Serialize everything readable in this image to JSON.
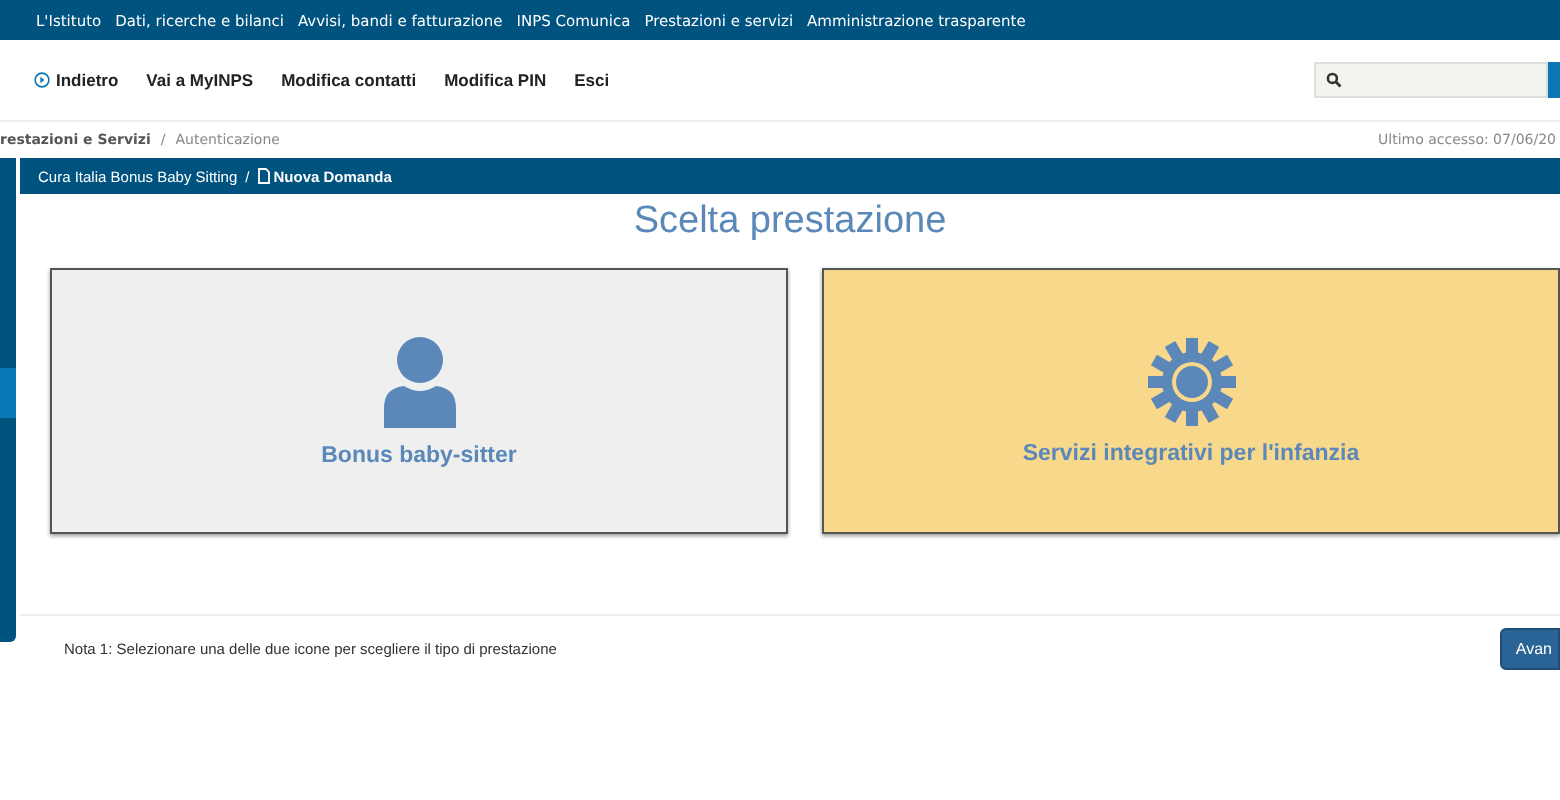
{
  "top_menu": [
    "L'Istituto",
    "Dati, ricerche e bilanci",
    "Avvisi, bandi e fatturazione",
    "INPS Comunica",
    "Prestazioni e servizi",
    "Amministrazione trasparente"
  ],
  "nav": {
    "back": "Indietro",
    "links": [
      "Vai a MyINPS",
      "Modifica contatti",
      "Modifica PIN",
      "Esci"
    ]
  },
  "breadcrumb": {
    "items": [
      "restazioni e Servizi",
      "Autenticazione"
    ],
    "separator": "/",
    "last_access": "Ultimo accesso: 07/06/20"
  },
  "panel": {
    "path": "Cura Italia Bonus Baby Sitting",
    "separator": "/",
    "current": "Nuova Domanda",
    "title": "Scelta prestazione",
    "choices": [
      {
        "kind": "person",
        "label": "Bonus baby-sitter",
        "selected": false
      },
      {
        "kind": "gear",
        "label": "Servizi integrativi per l'infanzia",
        "selected": true
      }
    ]
  },
  "footer": {
    "note": "Nota 1: Selezionare una delle due icone per scegliere il tipo di prestazione",
    "button": "Avan"
  }
}
